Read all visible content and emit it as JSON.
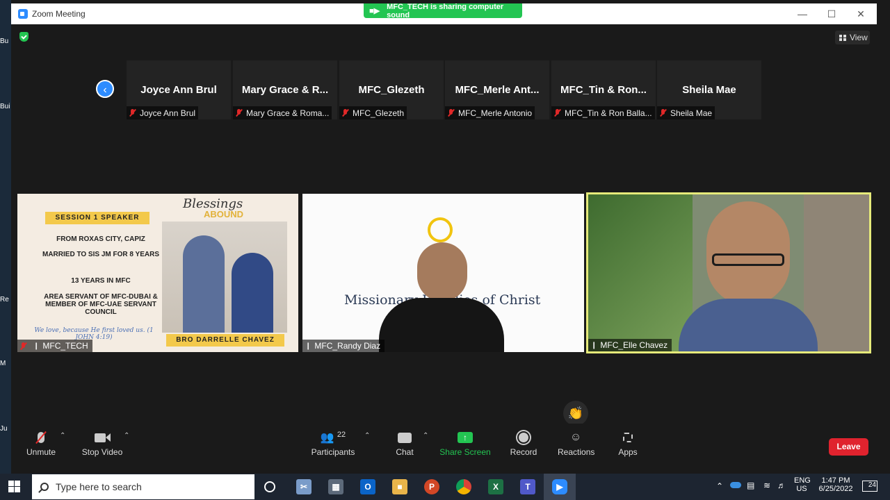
{
  "window": {
    "title": "Zoom Meeting"
  },
  "banner": {
    "text": "MFC_TECH is sharing computer sound"
  },
  "view": {
    "label": "View"
  },
  "desktop_icons": [
    "Bu",
    "Bui",
    "",
    "Re",
    "M",
    "Ju"
  ],
  "gallery": [
    {
      "display": "Joyce Ann Brul",
      "label": "Joyce Ann Brul"
    },
    {
      "display": "Mary Grace & R...",
      "label": "Mary Grace & Roma..."
    },
    {
      "display": "MFC_Glezeth",
      "label": "MFC_Glezeth"
    },
    {
      "display": "MFC_Merle  Ant...",
      "label": "MFC_Merle Antonio"
    },
    {
      "display": "MFC_Tin & Ron...",
      "label": "MFC_Tin & Ron Balla..."
    },
    {
      "display": "Sheila Mae",
      "label": "Sheila Mae"
    }
  ],
  "videos": {
    "v1": {
      "label": "MFC_TECH",
      "slide": {
        "session": "SESSION 1 SPEAKER",
        "title_script": "Blessings",
        "title_bold": "ABOUND",
        "line1": "FROM ROXAS CITY, CAPIZ",
        "line2": "MARRIED TO SIS JM FOR 8 YEARS",
        "line3": "13 YEARS IN MFC",
        "line4": "AREA SERVANT OF MFC-DUBAI & MEMBER OF MFC-UAE SERVANT COUNCIL",
        "verse": "We love, because He first loved us. (1 JOHN 4:19)",
        "speaker": "BRO DARRELLE CHAVEZ"
      }
    },
    "v2": {
      "label": "MFC_Randy Diaz",
      "bg_text": "Missionary Families of Christ"
    },
    "v3": {
      "label": "MFC_Elle Chavez"
    }
  },
  "toolbar": {
    "unmute": "Unmute",
    "stop_video": "Stop Video",
    "participants": "Participants",
    "participants_count": "22",
    "chat": "Chat",
    "share_screen": "Share Screen",
    "record": "Record",
    "reactions": "Reactions",
    "apps": "Apps",
    "leave": "Leave"
  },
  "taskbar": {
    "search_placeholder": "Type here to search",
    "lang": "ENG",
    "region": "US",
    "time": "1:47 PM",
    "date": "6/25/2022",
    "notifications": "24"
  },
  "colors": {
    "accent": "#2d8cff",
    "share_green": "#23c552",
    "leave_red": "#e0232e",
    "active_speaker": "#e6ea7a"
  }
}
